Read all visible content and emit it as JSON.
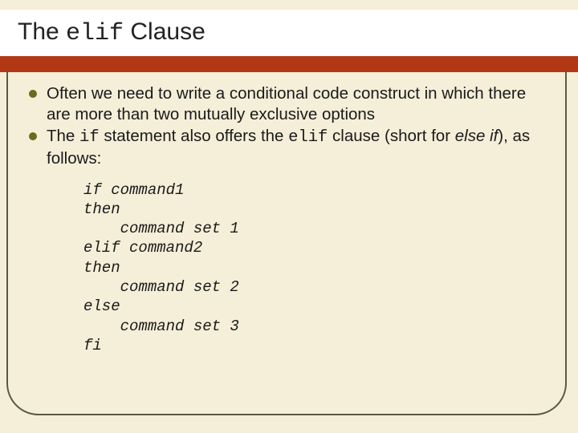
{
  "title": {
    "pre": "The ",
    "code": "elif",
    "post": " Clause"
  },
  "bullets": [
    {
      "text": "Often we need to write a conditional code construct in which there are more than two mutually exclusive options"
    },
    {
      "pre": "The ",
      "code1": "if",
      "mid1": " statement also offers the ",
      "code2": "elif",
      "mid2": " clause (short for ",
      "italic": "else if",
      "post": "), as follows:"
    }
  ],
  "code": "if command1\nthen\n    command set 1\nelif command2\nthen\n    command set 2\nelse\n    command set 3\nfi"
}
